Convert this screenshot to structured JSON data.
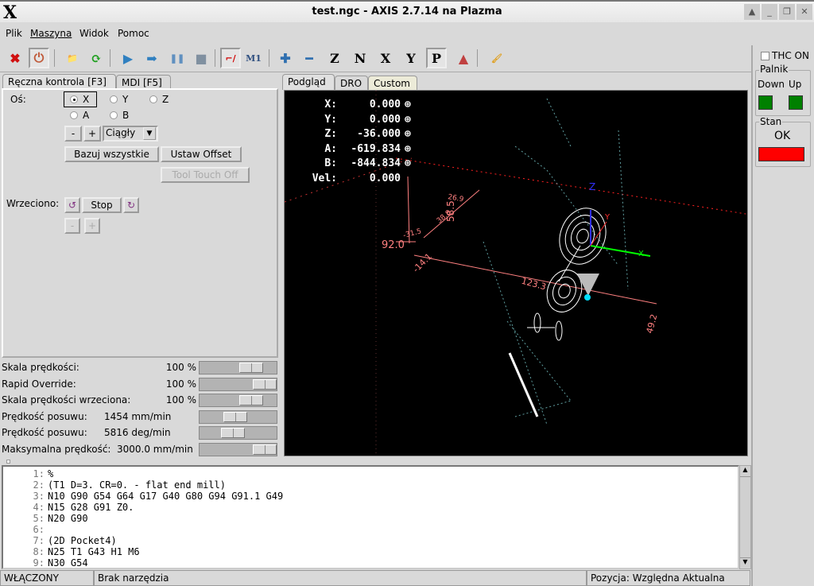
{
  "window": {
    "title": "test.ngc - AXIS 2.7.14 na Plazma",
    "logo": "X"
  },
  "menu": [
    "Plik",
    "Maszyna",
    "Widok",
    "Pomoc"
  ],
  "toolbar": [
    {
      "icon": "estop-icon",
      "glyph": "✖",
      "color": "#d01010"
    },
    {
      "icon": "power-icon",
      "glyph": "⏻",
      "color": "#c05a3a"
    },
    {
      "icon": "open-folder-icon",
      "glyph": "📁",
      "color": "#c8a060"
    },
    {
      "icon": "reload-icon",
      "glyph": "⟳",
      "color": "#20a020"
    },
    {
      "icon": "run-icon",
      "glyph": "▶",
      "color": "#3080c0"
    },
    {
      "icon": "step-icon",
      "glyph": "➡",
      "color": "#3080c0"
    },
    {
      "icon": "pause-icon",
      "glyph": "❚❚",
      "color": "#6090c0"
    },
    {
      "icon": "stop-icon",
      "glyph": "■",
      "color": "#8090a0"
    },
    {
      "icon": "block-delete-icon",
      "glyph": "⌐/",
      "color": "#d00000"
    },
    {
      "icon": "optional-stop-icon",
      "glyph": "M1",
      "color": "#305080"
    },
    {
      "icon": "zoom-in-icon",
      "glyph": "✚",
      "color": "#3070b0"
    },
    {
      "icon": "zoom-out-icon",
      "glyph": "━",
      "color": "#3070b0"
    },
    {
      "icon": "view-z-icon",
      "glyph": "Z",
      "color": "#000"
    },
    {
      "icon": "view-z2-icon",
      "glyph": "N",
      "color": "#000"
    },
    {
      "icon": "view-x-icon",
      "glyph": "X",
      "color": "#000"
    },
    {
      "icon": "view-y-icon",
      "glyph": "Y",
      "color": "#000"
    },
    {
      "icon": "view-p-icon",
      "glyph": "P",
      "color": "#000"
    },
    {
      "icon": "rotate-view-icon",
      "glyph": "▲",
      "color": "#c04040"
    },
    {
      "icon": "clear-plot-icon",
      "glyph": "🖌",
      "color": "#e0a020"
    }
  ],
  "left_tabs": [
    "Ręczna kontrola [F3]",
    "MDI [F5]"
  ],
  "manual": {
    "axis_label": "Oś:",
    "axes": [
      "X",
      "Y",
      "Z",
      "A",
      "B"
    ],
    "selected_axis": "X",
    "minus": "-",
    "plus": "+",
    "jog_mode": "Ciągły",
    "home_all": "Bazuj wszystkie",
    "set_offset": "Ustaw Offset",
    "tool_touch_off": "Tool Touch Off",
    "spindle_label": "Wrzeciono:",
    "spindle_stop": "Stop"
  },
  "sliders": [
    {
      "label": "Skala prędkości:",
      "value": "100 %",
      "fraction": 0.75
    },
    {
      "label": "Rapid Override:",
      "value": "100 %",
      "fraction": 1.0
    },
    {
      "label": "Skala prędkości wrzeciona:",
      "value": "100 %",
      "fraction": 0.75
    },
    {
      "label": "Prędkość posuwu:",
      "value": "1454 mm/min",
      "fraction": 0.45
    },
    {
      "label": "Prędkość posuwu:",
      "value": "5816 deg/min",
      "fraction": 0.4
    },
    {
      "label": "Maksymalna prędkość:",
      "value": "3000.0 mm/min",
      "fraction": 1.0
    }
  ],
  "preview_tabs": [
    "Podgląd",
    "DRO",
    "Custom"
  ],
  "dro": [
    {
      "axis": "X:",
      "value": "0.000"
    },
    {
      "axis": "Y:",
      "value": "0.000"
    },
    {
      "axis": "Z:",
      "value": "-36.000"
    },
    {
      "axis": "A:",
      "value": "-619.834"
    },
    {
      "axis": "B:",
      "value": "-844.834"
    },
    {
      "axis": "Vel:",
      "value": "0.000"
    }
  ],
  "preview_labels": {
    "dim1": "58.5",
    "dim2": "92.0",
    "dim3": "-14.1",
    "dim4": "123.3",
    "dim5": "49.2",
    "dim6": "-31.5",
    "dim7": "38.8",
    "dim8": "26.9",
    "axis_z": "Z",
    "axis_y": "Y",
    "axis_x": "X"
  },
  "colors": {
    "extents": "#ff8080",
    "toolpath": "#ffffff",
    "rapid": "#5f9ea0",
    "axis_x": "#00ff00",
    "axis_y": "#ff3030",
    "axis_z": "#3030ff",
    "torch_down": "#008000",
    "torch_up": "#008000",
    "status": "#ff0000"
  },
  "right": {
    "thc": "THC ON",
    "thc_checked": false,
    "palnik": "Palnik",
    "down": "Down",
    "up": "Up",
    "stan": "Stan",
    "stan_value": "OK"
  },
  "gcode": [
    {
      "n": "1:",
      "text": "%"
    },
    {
      "n": "2:",
      "text": "(T1 D=3. CR=0. - flat end mill)"
    },
    {
      "n": "3:",
      "text": "N10 G90 G54 G64 G17 G40 G80 G94 G91.1 G49"
    },
    {
      "n": "4:",
      "text": "N15 G28 G91 Z0."
    },
    {
      "n": "5:",
      "text": "N20 G90"
    },
    {
      "n": "6:",
      "text": ""
    },
    {
      "n": "7:",
      "text": "(2D Pocket4)"
    },
    {
      "n": "8:",
      "text": "N25 T1 G43 H1 M6"
    },
    {
      "n": "9:",
      "text": "N30 G54"
    }
  ],
  "status": {
    "state": "WŁĄCZONY",
    "tool": "Brak narzędzia",
    "position": "Pozycja: Względna Aktualna"
  }
}
